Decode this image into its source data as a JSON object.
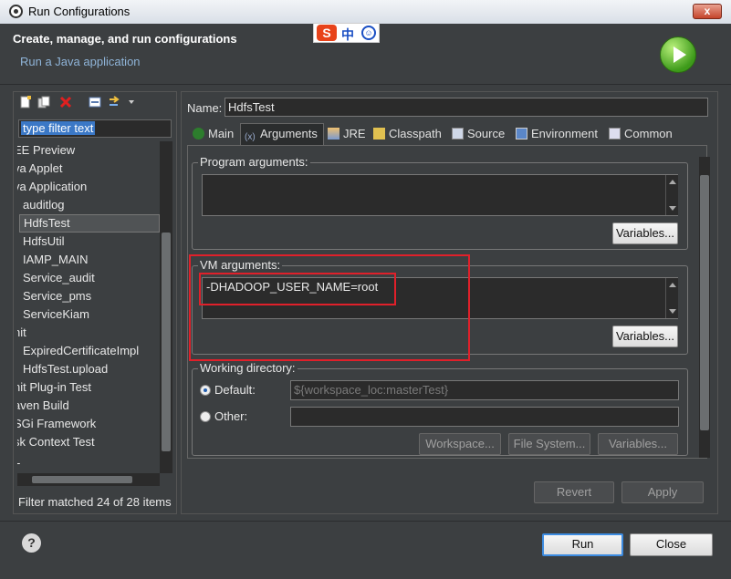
{
  "window": {
    "title": "Run Configurations"
  },
  "header": {
    "title": "Create, manage, and run configurations",
    "subtitle": "Run a Java application",
    "ime": {
      "logo": "S",
      "lang": "中",
      "emoji": "☺"
    }
  },
  "left_panel": {
    "toolbar_icons": [
      "new-config-icon",
      "duplicate-icon",
      "delete-icon",
      "collapse-all-icon",
      "filter-icon"
    ],
    "filter_placeholder": "type filter text",
    "tree": [
      {
        "label": "EE Preview",
        "indent": 0
      },
      {
        "label": "va Applet",
        "indent": 0
      },
      {
        "label": "va Application",
        "indent": 0
      },
      {
        "label": "auditlog",
        "indent": 1
      },
      {
        "label": "HdfsTest",
        "indent": 1,
        "selected": true
      },
      {
        "label": "HdfsUtil",
        "indent": 1
      },
      {
        "label": "IAMP_MAIN",
        "indent": 1
      },
      {
        "label": "Service_audit",
        "indent": 1
      },
      {
        "label": "Service_pms",
        "indent": 1
      },
      {
        "label": "ServiceKiam",
        "indent": 1
      },
      {
        "label": "nit",
        "indent": 0
      },
      {
        "label": "ExpiredCertificateImpl",
        "indent": 1
      },
      {
        "label": "HdfsTest.upload",
        "indent": 1
      },
      {
        "label": "nit Plug-in Test",
        "indent": 0
      },
      {
        "label": "aven Build",
        "indent": 0
      },
      {
        "label": "SGi Framework",
        "indent": 0
      },
      {
        "label": "sk Context Test",
        "indent": 0
      },
      {
        "label": "L",
        "indent": 0
      }
    ],
    "status": "Filter matched 24 of 28 items"
  },
  "config": {
    "name_label": "Name:",
    "name_value": "HdfsTest",
    "tabs": [
      {
        "label": "Main",
        "icon": "main-icon"
      },
      {
        "label": "Arguments",
        "icon": "arguments-icon",
        "active": true
      },
      {
        "label": "JRE",
        "icon": "jre-icon"
      },
      {
        "label": "Classpath",
        "icon": "classpath-icon"
      },
      {
        "label": "Source",
        "icon": "source-icon"
      },
      {
        "label": "Environment",
        "icon": "environment-icon"
      },
      {
        "label": "Common",
        "icon": "common-icon"
      }
    ],
    "program_args": {
      "label": "Program arguments:",
      "value": "",
      "variables": "Variables..."
    },
    "vm_args": {
      "label": "VM arguments:",
      "value": "-DHADOOP_USER_NAME=root",
      "variables": "Variables..."
    },
    "working_dir": {
      "label": "Working directory:",
      "default_label": "Default:",
      "default_value": "${workspace_loc:masterTest}",
      "other_label": "Other:",
      "other_value": "",
      "workspace_btn": "Workspace...",
      "filesystem_btn": "File System...",
      "variables_btn": "Variables..."
    },
    "revert": "Revert",
    "apply": "Apply"
  },
  "footer": {
    "help": "?",
    "run": "Run",
    "close": "Close"
  },
  "colors": {
    "highlight": "#e0202a",
    "selection": "#3b78c6"
  }
}
